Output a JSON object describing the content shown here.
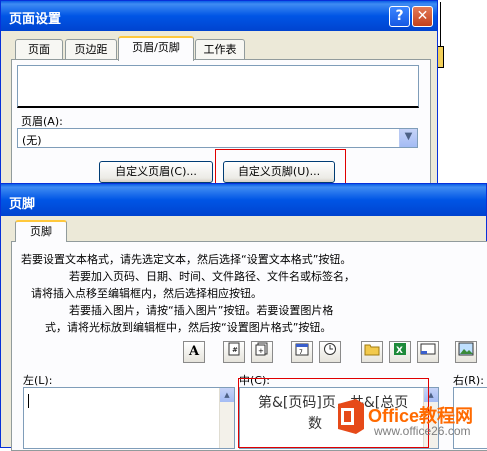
{
  "page_setup": {
    "title": "页面设置",
    "help_label": "?",
    "close_label": "✕",
    "tabs": [
      "页面",
      "页边距",
      "页眉/页脚",
      "工作表"
    ],
    "active_tab": "页眉/页脚",
    "header_label": "页眉(A):",
    "header_value": "(无)",
    "custom_header_button": "自定义页眉(C)...",
    "custom_footer_button": "自定义页脚(U)..."
  },
  "footer_dialog": {
    "title": "页脚",
    "tab": "页脚",
    "instructions": [
      "若要设置文本格式，请先选定文本，然后选择“设置文本格式”按钮。",
      "若要加入页码、日期、时间、文件路径、文件名或标签名，",
      "请将插入点移至编辑框内，然后选择相应按钮。",
      "若要插入图片，请按“插入图片”按钮。若要设置图片格",
      "式，请将光标放到编辑框中，然后按“设置图片格式”按钮。"
    ],
    "toolbar_icons": [
      "format-text-icon",
      "page-number-icon",
      "total-pages-icon",
      "date-icon",
      "time-icon",
      "file-path-icon",
      "file-name-icon",
      "sheet-name-icon",
      "insert-picture-icon"
    ],
    "left_label": "左(L):",
    "center_label": "中(C):",
    "right_label": "右(R):",
    "center_text_line1": "第&[页码]页，共&[总页",
    "center_text_line2": "数"
  },
  "watermark": {
    "brand": "Office教程网",
    "url": "www.office26.com"
  },
  "colors": {
    "title_bar": "#0055e5",
    "dialog_bg": "#ece9d8",
    "highlight": "#e00000",
    "watermark_orange": "#ff6a00"
  }
}
